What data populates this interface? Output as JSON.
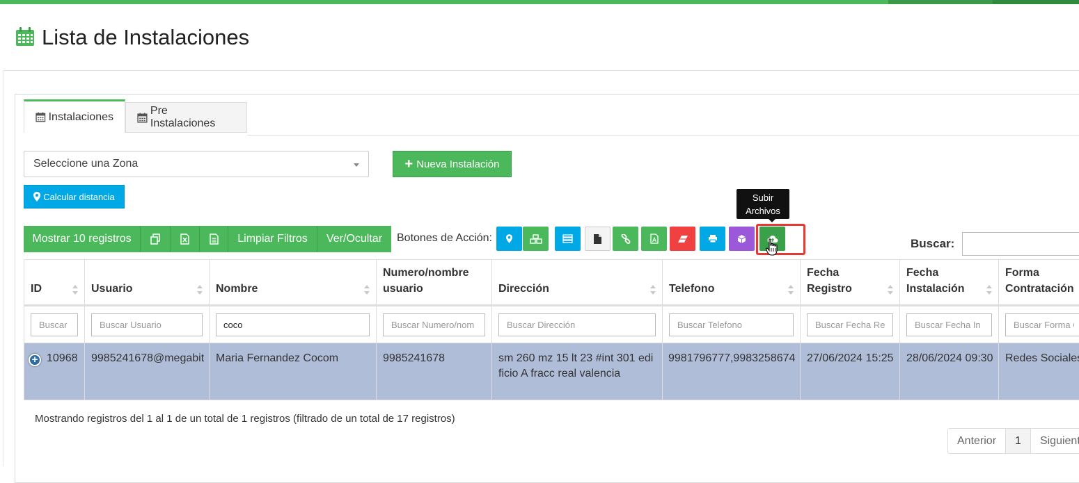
{
  "page": {
    "title": "Lista de Instalaciones"
  },
  "tabs": [
    {
      "label": "Instalaciones",
      "active": true
    },
    {
      "label": "Pre Instalaciones",
      "active": false
    }
  ],
  "zone_select": {
    "selected": "Seleccione una Zona"
  },
  "buttons": {
    "new_install": "Nueva Instalación",
    "calc_distance": "Calcular distancia"
  },
  "toolbar": {
    "show_records": "Mostrar 10 registros",
    "clear_filters": "Limpiar Filtros",
    "show_hide": "Ver/Ocultar",
    "actions_label": "Botones de Acción:"
  },
  "action_buttons": [
    {
      "icon": "map-marker-icon",
      "color": "#00a8e6"
    },
    {
      "icon": "cubes-icon",
      "color": "#4cb85c"
    },
    {
      "icon": "tasks-icon",
      "color": "#00a8e6"
    },
    {
      "icon": "file-icon",
      "color": "#f4f4f4"
    },
    {
      "icon": "link-icon",
      "color": "#4cb85c"
    },
    {
      "icon": "file-pdf-icon",
      "color": "#4cb85c"
    },
    {
      "icon": "eraser-icon",
      "color": "#f04040"
    },
    {
      "icon": "print-icon",
      "color": "#00a8e6"
    },
    {
      "icon": "cube-icon",
      "color": "#9b59d9"
    },
    {
      "icon": "cloud-upload-icon",
      "color": "#3aa14a"
    }
  ],
  "tooltip": {
    "text_line1": "Subir",
    "text_line2": "Archivos"
  },
  "search": {
    "label": "Buscar:",
    "value": ""
  },
  "table": {
    "columns": [
      {
        "line1": "",
        "line2": "ID"
      },
      {
        "line1": "",
        "line2": "Usuario"
      },
      {
        "line1": "",
        "line2": "Nombre"
      },
      {
        "line1": "Numero/nombre",
        "line2": "usuario"
      },
      {
        "line1": "",
        "line2": "Dirección"
      },
      {
        "line1": "",
        "line2": "Telefono"
      },
      {
        "line1": "Fecha",
        "line2": "Registro"
      },
      {
        "line1": "Fecha",
        "line2": "Instalación"
      },
      {
        "line1": "Forma",
        "line2": "Contratación"
      }
    ],
    "filters": [
      {
        "placeholder": "Buscar",
        "value": ""
      },
      {
        "placeholder": "Buscar Usuario",
        "value": ""
      },
      {
        "placeholder": "",
        "value": "coco"
      },
      {
        "placeholder": "Buscar Numero/nom",
        "value": ""
      },
      {
        "placeholder": "Buscar Dirección",
        "value": ""
      },
      {
        "placeholder": "Buscar Telefono",
        "value": ""
      },
      {
        "placeholder": "Buscar Fecha Re",
        "value": ""
      },
      {
        "placeholder": "Buscar Fecha In",
        "value": ""
      },
      {
        "placeholder": "Buscar Forma C",
        "value": ""
      }
    ],
    "rows": [
      {
        "id": "10968",
        "usuario": "9985241678@megabit",
        "nombre": "Maria Fernandez Cocom",
        "numero": "9985241678",
        "direccion": "sm 260 mz 15 lt 23 #int 301 edificio A fracc real valencia",
        "telefono": "9981796777,9983258674",
        "fecha_registro": "27/06/2024 15:25",
        "fecha_instalacion": "28/06/2024 09:30",
        "forma": "Redes Sociales"
      }
    ]
  },
  "footer": {
    "info": "Mostrando registros del 1 al 1 de un total de 1 registros (filtrado de un total de 17 registros)",
    "prev": "Anterior",
    "page": "1",
    "next": "Siguiente"
  },
  "colors": {
    "green": "#4cb85c",
    "blue": "#00a8e6",
    "row_selected": "#afbdd8",
    "highlight": "#e53935"
  }
}
